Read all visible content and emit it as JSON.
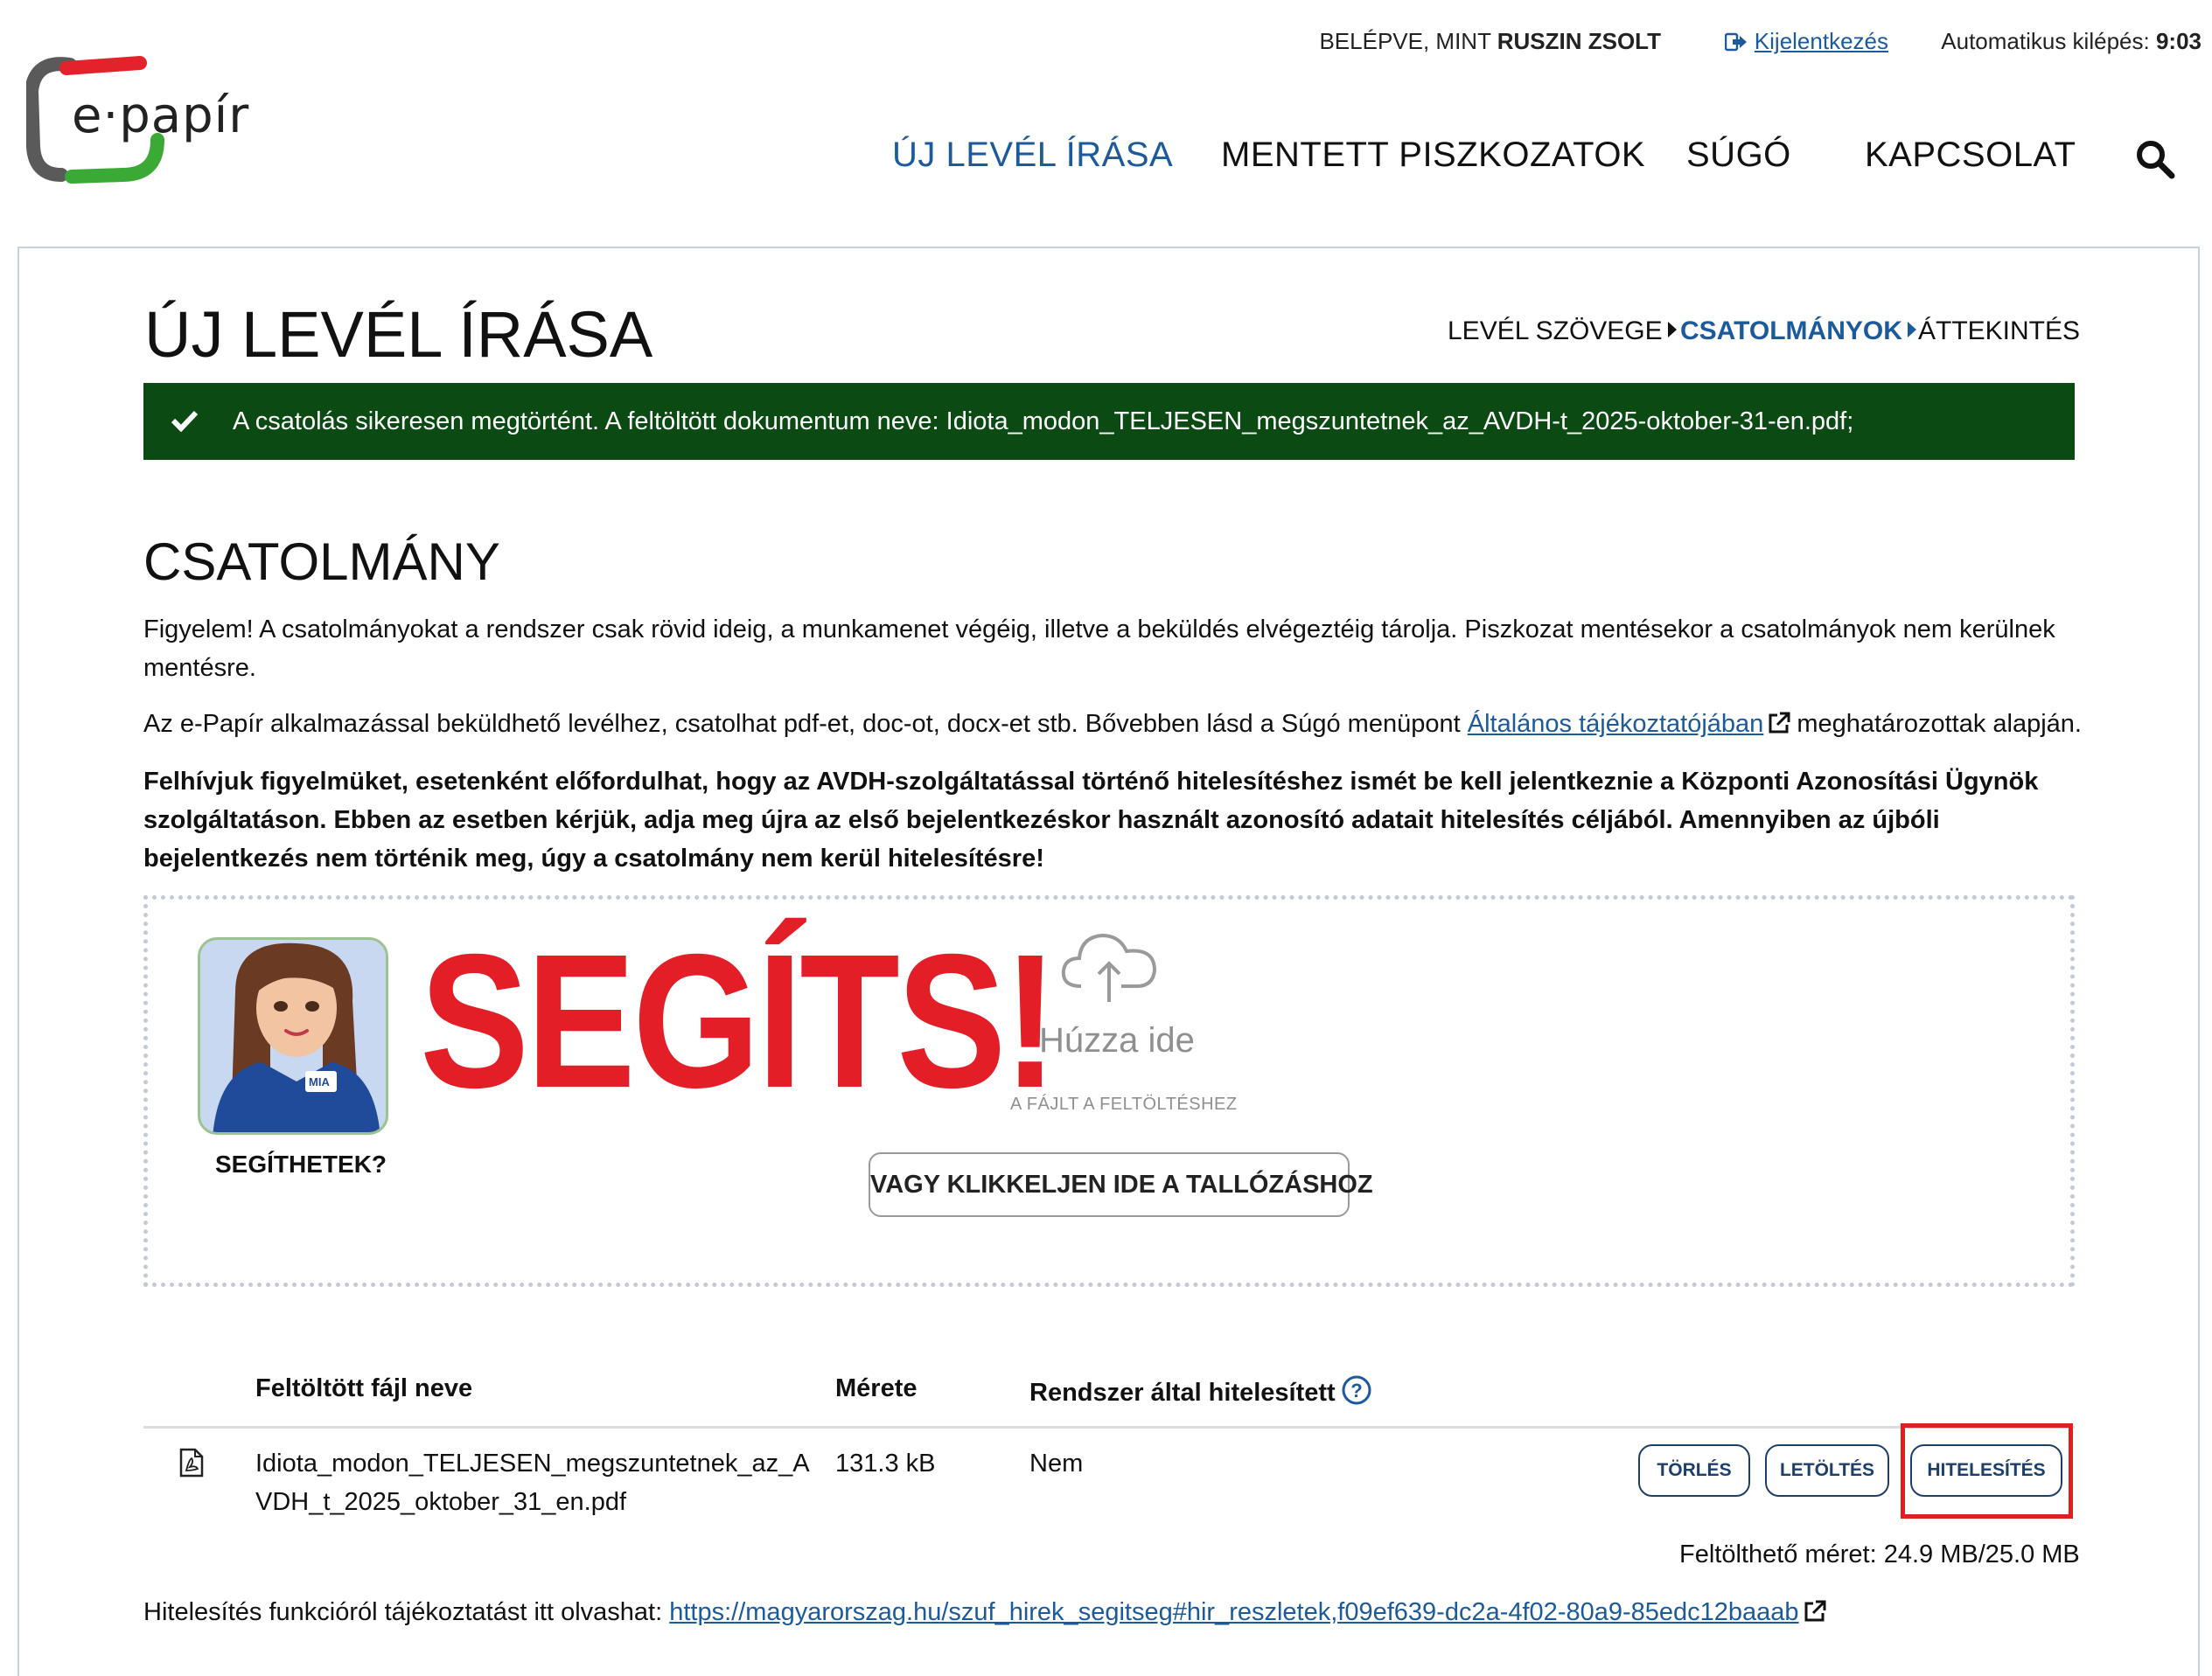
{
  "header": {
    "logo_text": "e·papír",
    "logged_in_prefix": "BELÉPVE, MINT",
    "logged_in_user": "RUSZIN ZSOLT",
    "logout_label": "Kijelentkezés",
    "autologout_label": "Automatikus kilépés:",
    "autologout_value": "9:03",
    "nav": [
      "ÚJ LEVÉL ÍRÁSA",
      "MENTETT PISZKOZATOK",
      "SÚGÓ",
      "KAPCSOLAT"
    ],
    "active_nav": "ÚJ LEVÉL ÍRÁSA",
    "search_icon": "search-icon"
  },
  "page": {
    "title": "ÚJ LEVÉL ÍRÁSA",
    "steps": [
      "LEVÉL SZÖVEGE",
      "CSATOLMÁNYOK",
      "ÁTTEKINTÉS"
    ],
    "active_step": "CSATOLMÁNYOK"
  },
  "alert": {
    "text": "A csatolás sikeresen megtörtént. A feltöltött dokumentum neve: Idiota_modon_TELJESEN_megszuntetnek_az_AVDH-t_2025-oktober-31-en.pdf;",
    "color": "#0b4a12"
  },
  "attachment": {
    "section_title": "CSATOLMÁNY",
    "para1": "Figyelem! A csatolmányokat a rendszer csak rövid ideig, a munkamenet végéig, illetve a beküldés elvégeztéig tárolja. Piszkozat mentésekor a csatolmányok nem kerülnek mentésre.",
    "para2_before": "Az e-Papír alkalmazással beküldhető levélhez, csatolhat pdf-et, doc-ot, docx-et stb. Bővebben lásd a Súgó menüpont",
    "para2_link": "Általános tájékoztatójában",
    "para2_after": "meghatározottak alapján.",
    "para3": "Felhívjuk figyelmüket, esetenként előfordulhat, hogy az AVDH-szolgáltatással történő hitelesítéshez ismét be kell jelentkeznie a Központi Azonosítási Ügynök szolgáltatáson. Ebben az esetben kérjük, adja meg újra az első bejelentkezéskor használt azonosító adatait hitelesítés céljából. Amennyiben az újbóli bejelentkezés nem történik meg, úgy a csatolmány nem kerül hitelesítésre!"
  },
  "dropzone": {
    "title": "Húzza ide",
    "subtitle": "A FÁJLT A FELTÖLTÉSHEZ",
    "browse_label": "VAGY KLIKKELJEN IDE A TALLÓZÁSHOZ"
  },
  "overlay": {
    "badge_text": "MIA",
    "caption": "SEGÍTHETEK?",
    "slogan": "SEGÍTS!",
    "slogan_color": "#e41e26"
  },
  "table": {
    "headers": [
      "Feltöltött fájl neve",
      "Mérete",
      "Rendszer által hitelesített"
    ],
    "rows": [
      {
        "name": "Idiota_modon_TELJESEN_megszuntetnek_az_AVDH_t_2025_oktober_31_en.pdf",
        "size": "131.3 kB",
        "authenticated": "Nem",
        "actions": [
          "TÖRLÉS",
          "LETÖLTÉS",
          "HITELESÍTÉS"
        ]
      }
    ],
    "upload_size_label": "Feltölthető méret:",
    "upload_size_value": "24.9 MB/25.0 MB"
  },
  "footer_info": {
    "label": "Hitelesítés funkcióról tájékoztatást itt olvashat:",
    "link": "https://magyarorszag.hu/szuf_hirek_segitseg#hir_reszletek,f09ef639-dc2a-4f02-80a9-85edc12baaab"
  }
}
